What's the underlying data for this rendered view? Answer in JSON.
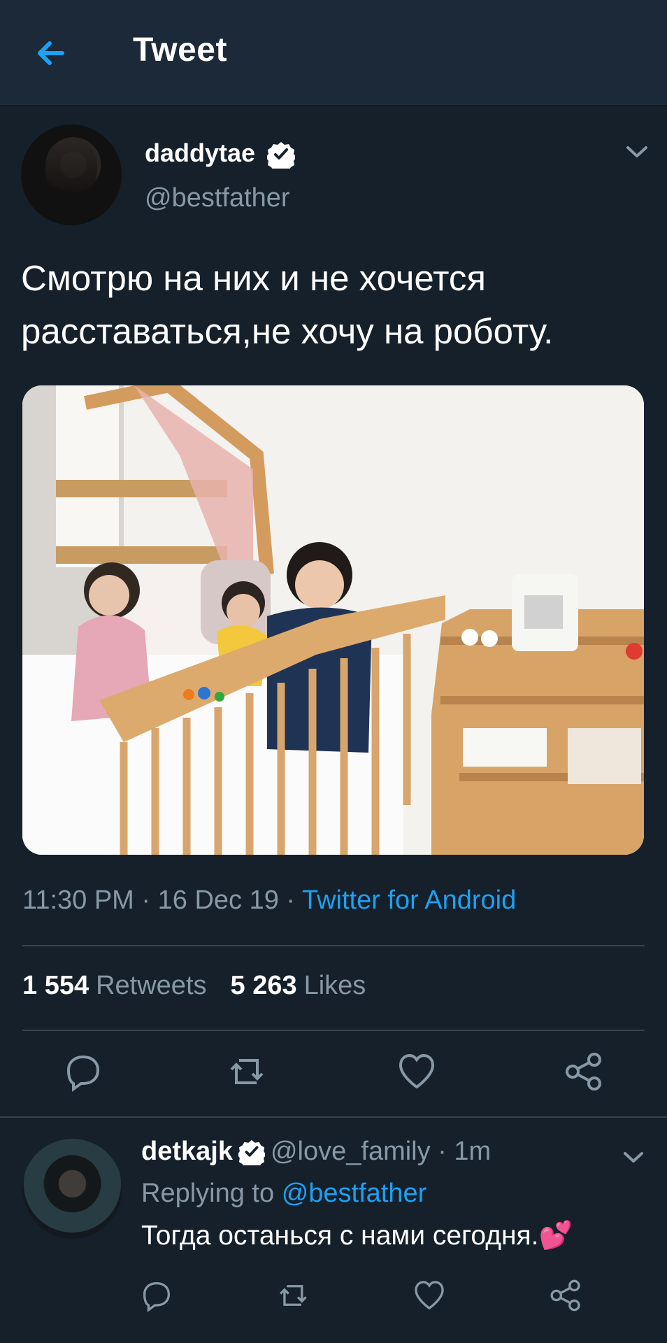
{
  "header": {
    "title": "Tweet"
  },
  "tweet": {
    "display_name": "daddytae",
    "handle": "@bestfather",
    "text": "Смотрю на них и не хочется расставаться,не хочу на роботу.",
    "time": "11:30 PM",
    "date": "16 Dec 19",
    "source": "Twitter for Android",
    "retweets_count": "1 554",
    "retweets_label": "Retweets",
    "likes_count": "5 263",
    "likes_label": "Likes"
  },
  "reply": {
    "display_name": "detkajk",
    "handle": "@love_family",
    "age": "1m",
    "replying_prefix": "Replying to",
    "replying_handle": "@bestfather",
    "text": "Тогда останься с нами сегодня.💕"
  },
  "colors": {
    "background": "#15202b",
    "header": "#1c2938",
    "accent": "#1da1f2",
    "secondary_text": "#8899a6"
  },
  "icons": {
    "back": "arrow-left-icon",
    "verified": "verified-badge-icon",
    "more": "chevron-down-icon",
    "reply": "reply-icon",
    "retweet": "retweet-icon",
    "like": "heart-icon",
    "share": "share-icon"
  }
}
